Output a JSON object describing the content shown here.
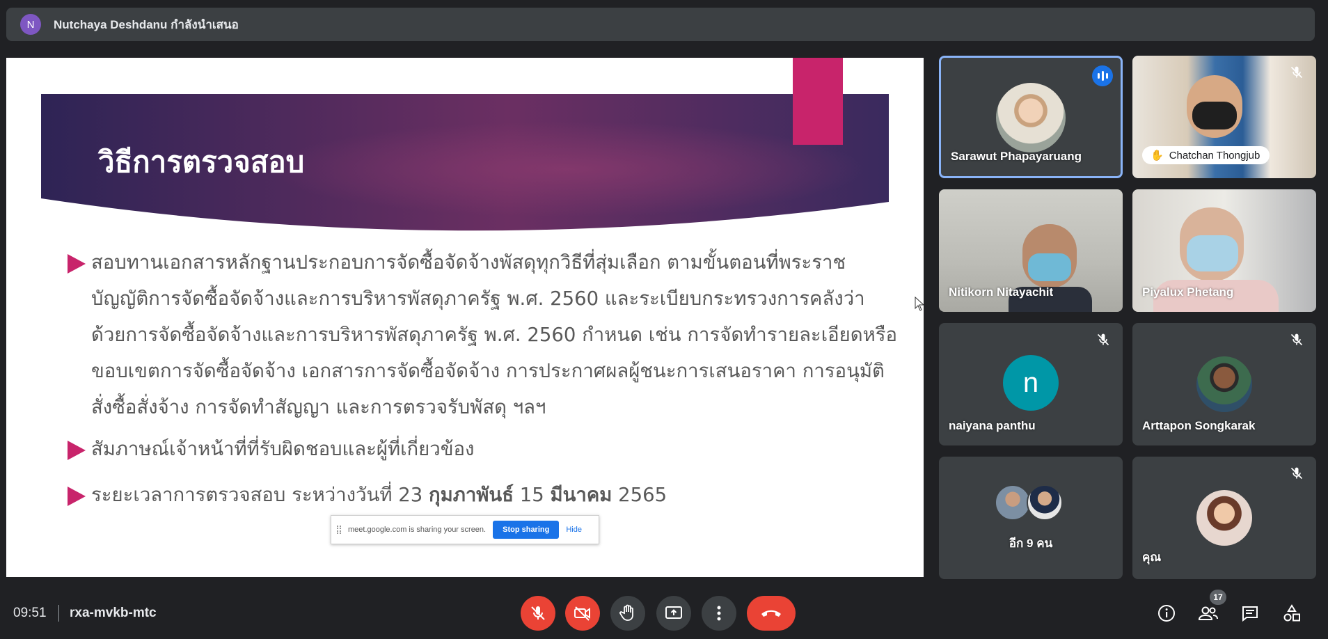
{
  "presenter": {
    "initial": "N",
    "label": "Nutchaya Deshdanu กำลังนำเสนอ"
  },
  "slide": {
    "title": "วิธีการตรวจสอบ",
    "bullet1": "สอบทานเอกสารหลักฐานประกอบการจัดซื้อจัดจ้างพัสดุทุกวิธีที่สุ่มเลือก ตามขั้นตอนที่พระราชบัญญัติการจัดซื้อจัดจ้างและการบริหารพัสดุภาครัฐ พ.ศ. 2560 และระเบียบกระทรวงการคลังว่าด้วยการจัดซื้อจัดจ้างและการบริหารพัสดุภาครัฐ พ.ศ. 2560 กำหนด เช่น การจัดทำรายละเอียดหรือขอบเขตการจัดซื้อจัดจ้าง เอกสารการจัดซื้อจัดจ้าง การประกาศผลผู้ชนะการเสนอราคา การอนุมัติสั่งซื้อสั่งจ้าง การจัดทำสัญญา และการตรวจรับพัสดุ ฯลฯ",
    "bullet2": "สัมภาษณ์เจ้าหน้าที่ที่รับผิดชอบและผู้ที่เกี่ยวข้อง",
    "bullet3_prefix": "ระยะเวลาการตรวจสอบ ระหว่างวันที่ 23 ",
    "bullet3_month1": "กุมภาพันธ์",
    "bullet3_mid": " 15 ",
    "bullet3_month2": "มีนาคม",
    "bullet3_suffix": " 2565",
    "colors": {
      "accent": "#c8246b",
      "banner_dark": "#3b2860",
      "banner_mid": "#6b2f62"
    }
  },
  "share_bar": {
    "text": "meet.google.com is sharing your screen.",
    "stop": "Stop sharing",
    "hide": "Hide"
  },
  "participants": [
    {
      "name": "Sarawut Phapayaruang",
      "state": "speaking"
    },
    {
      "name": "Chatchan Thongjub",
      "state": "muted",
      "hand_raised": true
    },
    {
      "name": "Nitikorn Nitayachit",
      "state": "video"
    },
    {
      "name": "Piyalux Phetang",
      "state": "video"
    },
    {
      "name": "naiyana panthu",
      "initial": "n",
      "state": "muted"
    },
    {
      "name": "Arttapon Songkarak",
      "state": "muted"
    },
    {
      "name": "อีก 9 คน",
      "state": "overflow"
    },
    {
      "name": "คุณ",
      "state": "muted"
    }
  ],
  "bottom_bar": {
    "time": "09:51",
    "meeting_code": "rxa-mvkb-mtc",
    "participant_count": "17",
    "icons": [
      "mic-off-icon",
      "camera-off-icon",
      "raise-hand-icon",
      "present-icon",
      "more-icon",
      "end-call-icon",
      "info-icon",
      "people-icon",
      "chat-icon",
      "activities-icon"
    ]
  }
}
